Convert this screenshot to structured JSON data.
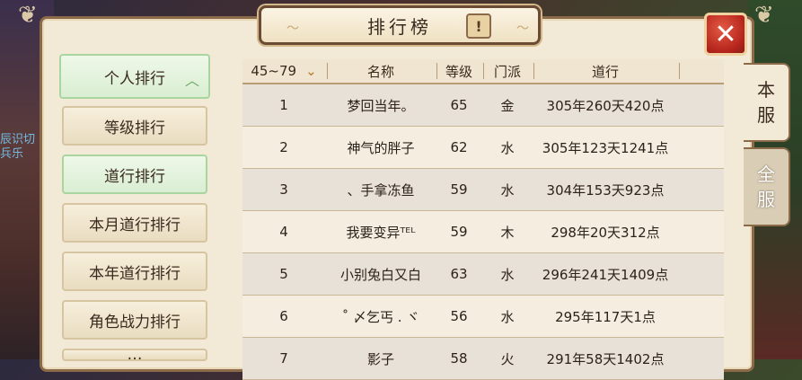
{
  "title": "排行榜",
  "help_label": "!",
  "close_label": "✕",
  "background_text": "辰识切\n兵乐",
  "menu": [
    {
      "label": "个人排行",
      "state": "expanded"
    },
    {
      "label": "等级排行"
    },
    {
      "label": "道行排行",
      "state": "selected"
    },
    {
      "label": "本月道行排行"
    },
    {
      "label": "本年道行排行"
    },
    {
      "label": "角色战力排行"
    },
    {
      "label": "…"
    }
  ],
  "table": {
    "level_filter": "45~79",
    "headers": [
      "名称",
      "等级",
      "门派",
      "道行"
    ],
    "rows": [
      {
        "rank": "1",
        "name": "梦回当年。",
        "level": "65",
        "school": "金",
        "daohang": "305年260天420点"
      },
      {
        "rank": "2",
        "name": "神气的胖子",
        "level": "62",
        "school": "水",
        "daohang": "305年123天1241点"
      },
      {
        "rank": "3",
        "name": "、手拿冻鱼",
        "level": "59",
        "school": "水",
        "daohang": "304年153天923点"
      },
      {
        "rank": "4",
        "name": "我要变异ᵀᴱᴸ",
        "level": "59",
        "school": "木",
        "daohang": "298年20天312点"
      },
      {
        "rank": "5",
        "name": "小别兔白又白",
        "level": "63",
        "school": "水",
        "daohang": "296年241天1409点"
      },
      {
        "rank": "6",
        "name": "˚ 〆乞丐 . ヾ",
        "level": "56",
        "school": "水",
        "daohang": "295年117天1点"
      },
      {
        "rank": "7",
        "name": "影子",
        "level": "58",
        "school": "火",
        "daohang": "291年58天1402点"
      }
    ]
  },
  "side_tabs": [
    {
      "label": "本\n服",
      "state": "active"
    },
    {
      "label": "全\n服",
      "state": "inactive"
    }
  ]
}
